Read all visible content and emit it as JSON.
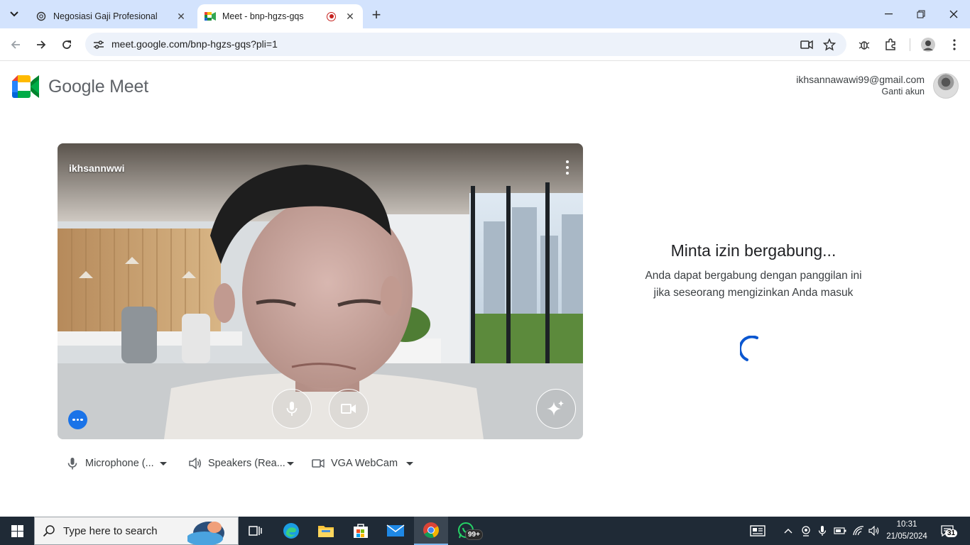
{
  "browser": {
    "tabs": [
      {
        "title": "Negosiasi Gaji Profesional",
        "active": false,
        "icon": "openai-icon"
      },
      {
        "title": "Meet - bnp-hgzs-gqs",
        "active": true,
        "icon": "meet-icon",
        "recording": true
      }
    ],
    "new_tab_label": "+",
    "url": "meet.google.com/bnp-hgzs-gqs?pli=1"
  },
  "meet": {
    "brand": "Google Meet",
    "account_email": "ikhsannawawi99@gmail.com",
    "switch_account": "Ganti akun",
    "preview_name": "ikhsannwwi",
    "join_title": "Minta izin bergabung...",
    "join_desc": "Anda dapat bergabung dengan panggilan ini jika seseorang mengizinkan Anda masuk",
    "devices": {
      "microphone": "Microphone (...",
      "speakers": "Speakers (Rea...",
      "camera": "VGA WebCam"
    },
    "colors": {
      "accent": "#1a73e8",
      "spinner": "#0b57d0"
    }
  },
  "taskbar": {
    "search_placeholder": "Type here to search",
    "whatsapp_badge": "99+",
    "time": "10:31",
    "date": "21/05/2024",
    "notifications": "31"
  }
}
